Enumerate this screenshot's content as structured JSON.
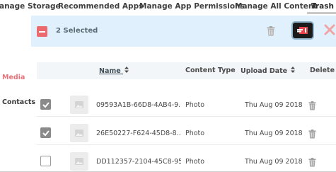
{
  "tabs": [
    {
      "label": "anage Storage"
    },
    {
      "label": "Recommended Apps"
    },
    {
      "label": "Manage App Permissions"
    },
    {
      "label": "Manage All Content"
    },
    {
      "label": "Trash"
    }
  ],
  "nav": {
    "items": [
      {
        "label": "Media",
        "active": true
      },
      {
        "label": "Contacts",
        "active": false
      }
    ]
  },
  "selection_bar": {
    "text": "2 Selected",
    "icons": [
      "minus-checkbox-icon",
      "trash-icon",
      "move-to-folder-icon",
      "close-icon"
    ]
  },
  "table": {
    "columns": {
      "name": "Name",
      "content_type": "Content Type",
      "upload_date": "Upload Date",
      "delete": "Delete"
    },
    "rows": [
      {
        "checked": true,
        "name": "09593A1B-66D8-4AB4-9...",
        "content_type": "Photo",
        "upload_date": "Thu Aug 09 2018"
      },
      {
        "checked": true,
        "name": "26E50227-F624-45D8-8...",
        "content_type": "Photo",
        "upload_date": "Thu Aug 09 2018"
      },
      {
        "checked": false,
        "name": "DD112357-2104-45C8-95...",
        "content_type": "Photo",
        "upload_date": "Thu Aug 09 2018"
      }
    ]
  },
  "colors": {
    "accent": "#ec6a6e",
    "selection_bar_bg": "#e0f1fd",
    "close_icon": "#f1a3a6"
  }
}
